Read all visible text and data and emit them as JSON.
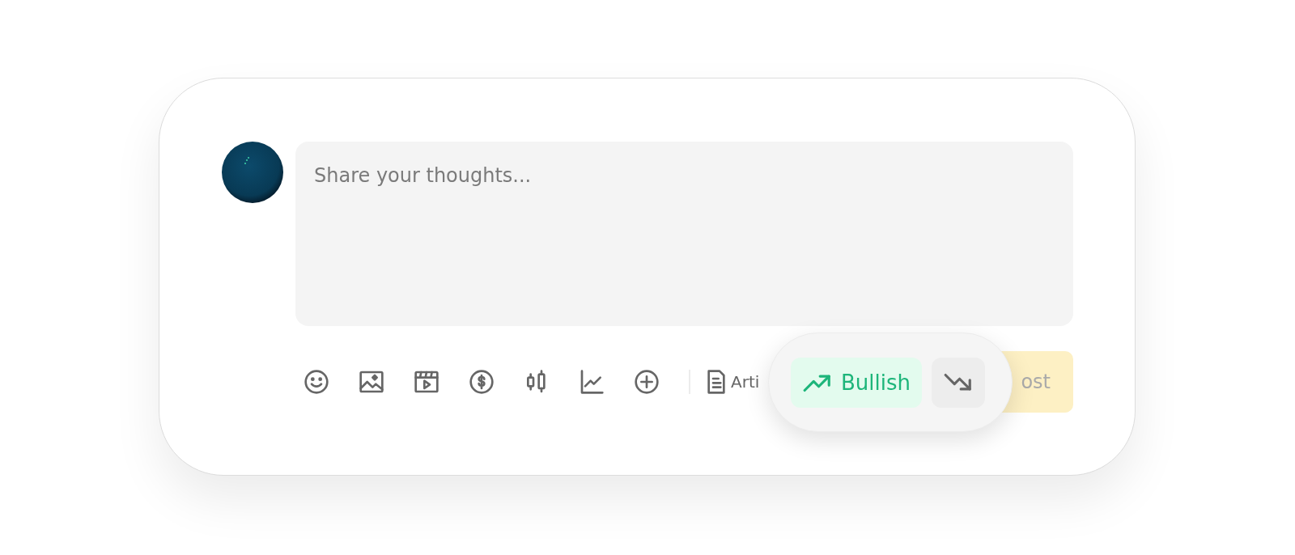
{
  "composer": {
    "placeholder": "Share your thoughts...",
    "toolbar": [
      {
        "kind": "emoji"
      },
      {
        "kind": "image"
      },
      {
        "kind": "video"
      },
      {
        "kind": "dollar"
      },
      {
        "kind": "candles"
      },
      {
        "kind": "chart"
      },
      {
        "kind": "plus"
      }
    ],
    "article": {
      "label": "Arti"
    },
    "post": {
      "label": "ost",
      "disabled": true
    },
    "sentiment": [
      {
        "kind": "bullish",
        "label": "Bullish",
        "selected": true
      },
      {
        "kind": "bearish",
        "selected": false
      }
    ]
  }
}
